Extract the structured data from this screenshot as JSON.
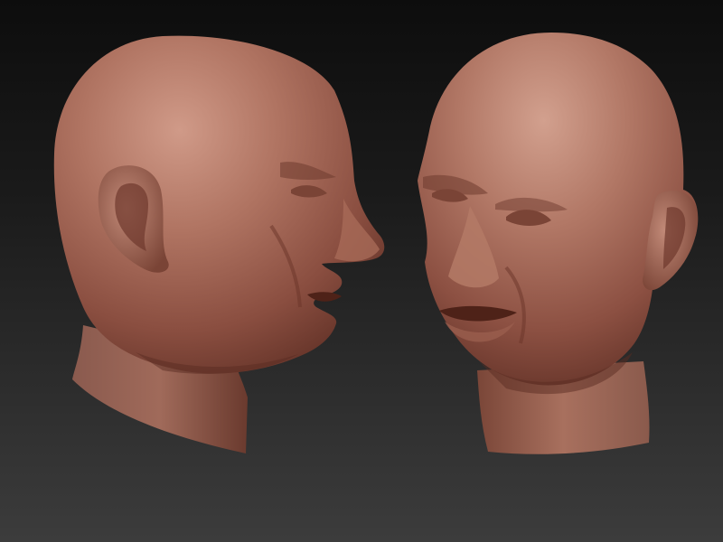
{
  "scene": {
    "description_tags": [
      "sculpt-render"
    ],
    "colors": {
      "background_top": "#0d0d0d",
      "background_bottom": "#3c3c3c",
      "clay_light": "#c08a78",
      "clay_mid": "#9a5e4e",
      "clay_dark": "#5a2c22"
    },
    "models": [
      {
        "name": "head-profile",
        "view": "side"
      },
      {
        "name": "head-three-quarter",
        "view": "three-quarter"
      }
    ]
  }
}
